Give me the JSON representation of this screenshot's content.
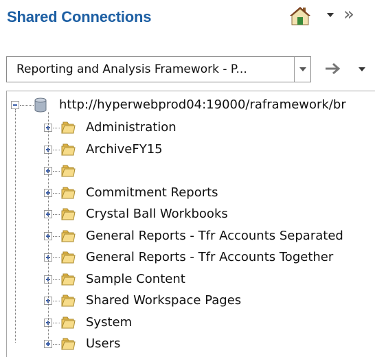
{
  "header": {
    "title": "Shared Connections",
    "icons": [
      "home-icon",
      "dropdown-arrow-icon",
      "double-chevron-right-icon"
    ]
  },
  "connection_select": {
    "value": "Reporting and Analysis Framework - P...",
    "button_icon": "chevron-down-icon",
    "go_icon": "arrow-right-icon",
    "menu_icon": "dropdown-arrow-icon"
  },
  "tree": {
    "root": {
      "label": "http://hyperwebprod04:19000/raframework/br",
      "icon": "database-icon",
      "expanded": true
    },
    "items": [
      {
        "label": "Administration"
      },
      {
        "label": "ArchiveFY15"
      },
      {
        "label": ""
      },
      {
        "label": "Commitment Reports"
      },
      {
        "label": "Crystal Ball Workbooks"
      },
      {
        "label": "General Reports - Tfr Accounts Separated"
      },
      {
        "label": "General Reports - Tfr Accounts Together"
      },
      {
        "label": "Sample Content"
      },
      {
        "label": "Shared Workspace Pages"
      },
      {
        "label": "System"
      },
      {
        "label": "Users"
      }
    ]
  },
  "colors": {
    "title": "#1d5fa3",
    "folder": "#f0c860",
    "border": "#8a8a8a"
  }
}
